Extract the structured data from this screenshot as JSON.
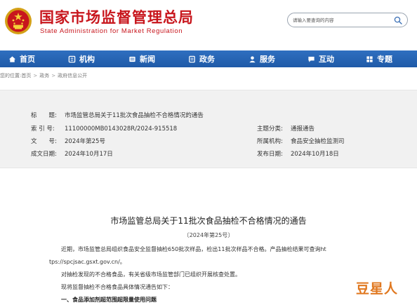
{
  "header": {
    "org_name_cn": "国家市场监督管理总局",
    "org_name_en": "State Administration for Market Regulation",
    "search_placeholder": "请输入要查询的内容"
  },
  "nav": {
    "items": [
      {
        "label": "首页",
        "icon": "home-icon"
      },
      {
        "label": "机构",
        "icon": "org-icon"
      },
      {
        "label": "新闻",
        "icon": "news-icon"
      },
      {
        "label": "政务",
        "icon": "affairs-icon"
      },
      {
        "label": "服务",
        "icon": "service-icon"
      },
      {
        "label": "互动",
        "icon": "interaction-icon"
      },
      {
        "label": "专题",
        "icon": "topic-icon"
      }
    ]
  },
  "breadcrumb": [
    "您的位置:首页",
    "政务",
    "政府信息公开"
  ],
  "doc_info": {
    "title_key": "标　　题:",
    "title_value": "市场监管总局关于11批次食品抽检不合格情况的通告",
    "index_key": "索 引 号:",
    "index_value": "11100000MB0143028R/2024-915518",
    "docno_key": "文　　号:",
    "docno_value": "2024年第25号",
    "date_key": "成文日期:",
    "date_value": "2024年10月17日",
    "category_key": "主题分类:",
    "category_value": "通报通告",
    "issuer_key": "所属机构:",
    "issuer_value": "食品安全抽检监测司",
    "publish_key": "发布日期:",
    "publish_value": "2024年10月18日"
  },
  "article": {
    "title": "市场监管总局关于11批次食品抽检不合格情况的通告",
    "doc_number": "〔2024年第25号〕",
    "para1_line1": "近期，市场监管总局组织食品安全监督抽检650批次样品，检出11批次样品不合格。产品抽检结果可查询ht",
    "para1_line2": "tps://spcjsac.gsxt.gov.cn/。",
    "para2": "对抽检发现的不合格食品，有关省级市场监管部门已组织开展核查处置。",
    "para3": "现将监督抽检不合格食品具体情况通告如下：",
    "section1": "一、食品添加剂超范围超限量使用问题"
  },
  "watermark": "豆星人",
  "colors": {
    "brand_red": "#c8161d",
    "nav_blue": "#1f5aa8",
    "info_bg": "#f1f1f1",
    "watermark_orange": "#e07820"
  }
}
